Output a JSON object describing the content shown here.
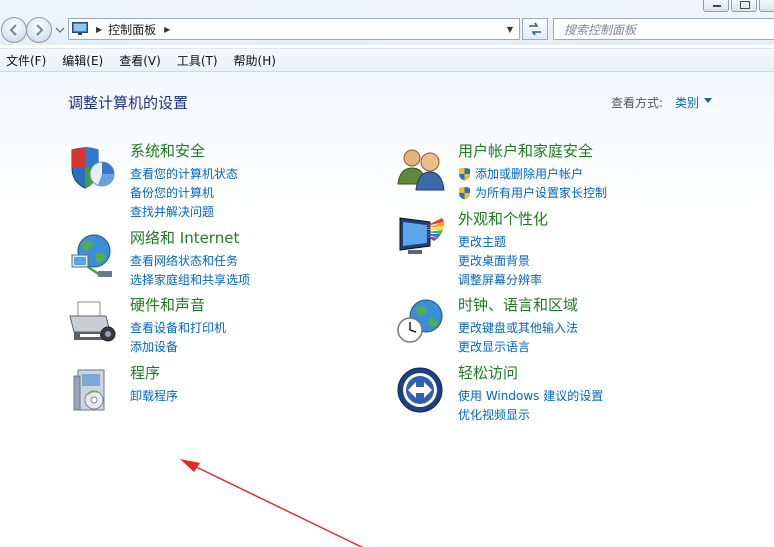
{
  "addressbar": {
    "breadcrumb": "控制面板",
    "search_placeholder": "搜索控制面板"
  },
  "menubar": {
    "items": [
      "文件(F)",
      "编辑(E)",
      "查看(V)",
      "工具(T)",
      "帮助(H)"
    ]
  },
  "main": {
    "title": "调整计算机的设置",
    "view_by_label": "查看方式:",
    "view_by_value": "类别"
  },
  "categories": {
    "system": {
      "title": "系统和安全",
      "links": [
        "查看您的计算机状态",
        "备份您的计算机",
        "查找并解决问题"
      ]
    },
    "network": {
      "title": "网络和 Internet",
      "links": [
        "查看网络状态和任务",
        "选择家庭组和共享选项"
      ]
    },
    "hardware": {
      "title": "硬件和声音",
      "links": [
        "查看设备和打印机",
        "添加设备"
      ]
    },
    "programs": {
      "title": "程序",
      "links": [
        "卸载程序"
      ]
    },
    "users": {
      "title": "用户帐户和家庭安全",
      "links": [
        "添加或删除用户帐户",
        "为所有用户设置家长控制"
      ]
    },
    "appearance": {
      "title": "外观和个性化",
      "links": [
        "更改主题",
        "更改桌面背景",
        "调整屏幕分辨率"
      ]
    },
    "clock": {
      "title": "时钟、语言和区域",
      "links": [
        "更改键盘或其他输入法",
        "更改显示语言"
      ]
    },
    "ease": {
      "title": "轻松访问",
      "links": [
        "使用 Windows 建议的设置",
        "优化视频显示"
      ]
    }
  },
  "annotation": {
    "arrow_color": "#e8262a"
  },
  "colors": {
    "link": "#0066cc",
    "category_title": "#1e7d1e",
    "page_title": "#1e3287"
  }
}
